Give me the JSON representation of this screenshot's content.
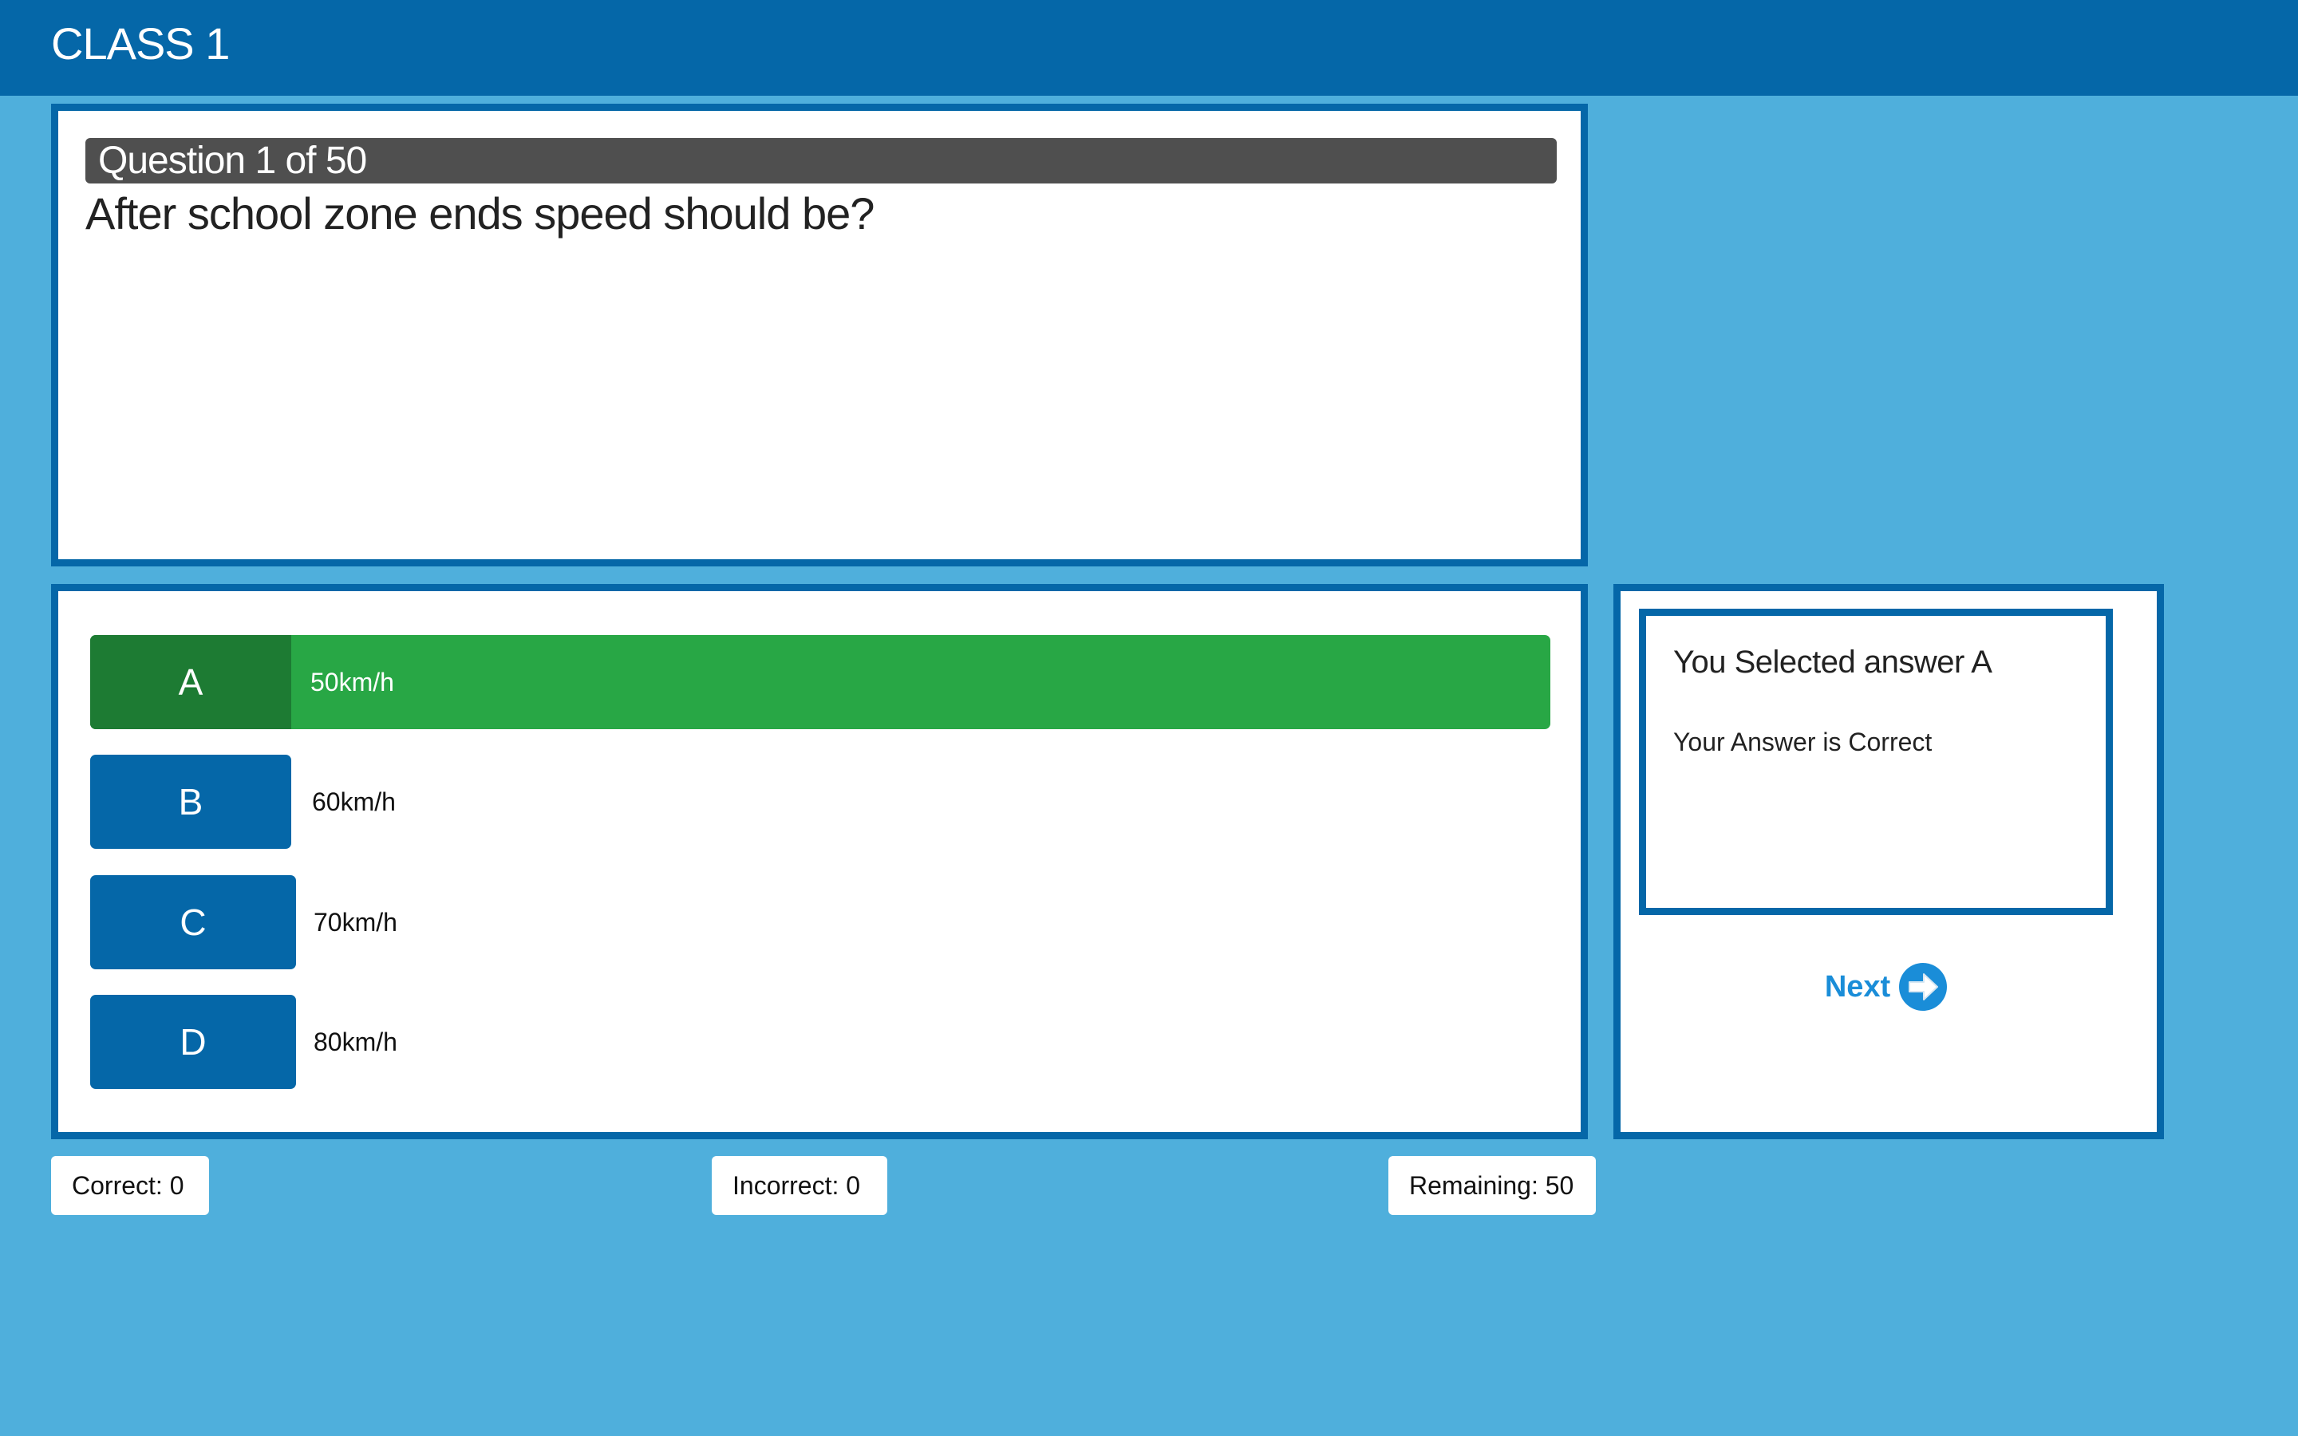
{
  "header": {
    "title": "CLASS 1"
  },
  "question": {
    "counter": "Question 1 of 50",
    "text": "After school zone ends speed should be?"
  },
  "answers": [
    {
      "letter": "A",
      "text": "50km/h",
      "selected": true
    },
    {
      "letter": "B",
      "text": "60km/h",
      "selected": false
    },
    {
      "letter": "C",
      "text": "70km/h",
      "selected": false
    },
    {
      "letter": "D",
      "text": "80km/h",
      "selected": false
    }
  ],
  "feedback": {
    "title": "You Selected answer A",
    "result": "Your Answer is Correct"
  },
  "next_button": {
    "label": "Next",
    "icon": "arrow-right-circle-icon"
  },
  "stats": {
    "correct": "Correct: 0",
    "incorrect": "Incorrect: 0",
    "remaining": "Remaining: 50"
  },
  "colors": {
    "background": "#4fafdc",
    "header": "#0567a8",
    "answer_button": "#0567a8",
    "selected": "#28a745",
    "selected_letter": "#1d7b33",
    "next": "#1a8dd8"
  }
}
